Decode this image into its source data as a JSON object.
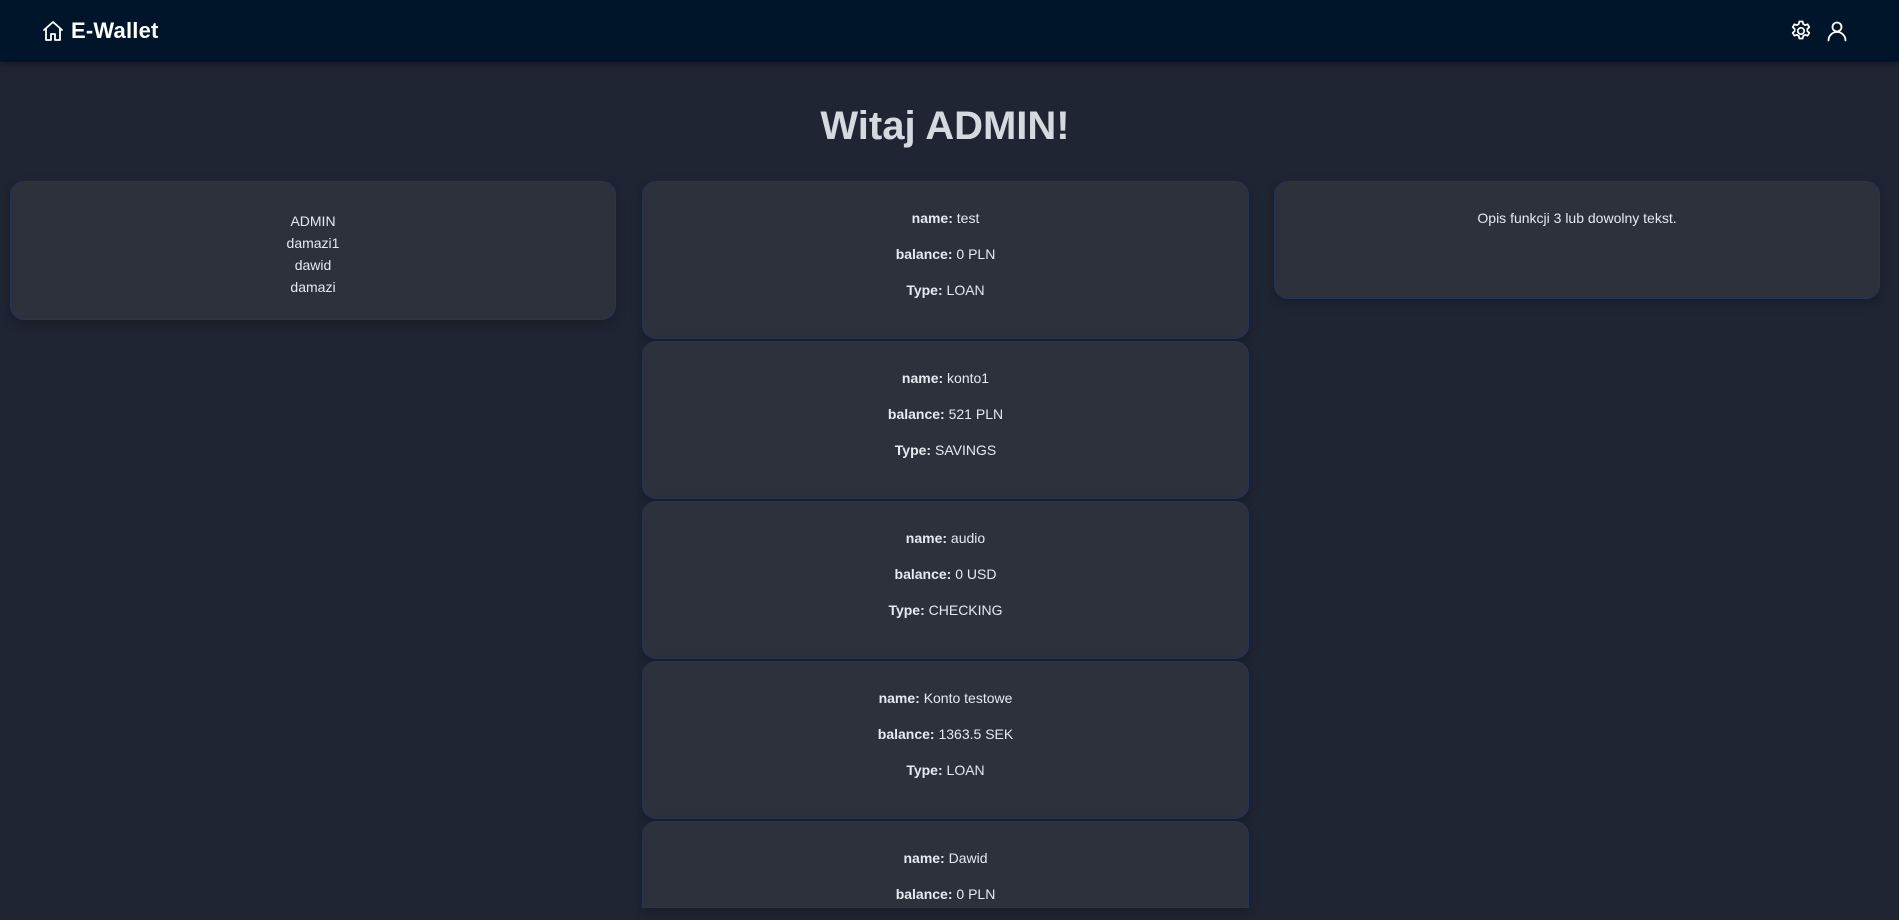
{
  "nav": {
    "title": "E-Wallet",
    "icons": [
      "home-icon",
      "settings-icon",
      "user-icon"
    ]
  },
  "greeting": "Witaj ADMIN!",
  "users": [
    "ADMIN",
    "damazi1",
    "dawid",
    "damazi"
  ],
  "info_text": "Opis funkcji 3 lub dowolny tekst.",
  "labels": {
    "name": "name:",
    "balance": "balance:",
    "type": "Type:"
  },
  "accounts": [
    {
      "name": "test",
      "balance": "0 PLN",
      "type": "LOAN"
    },
    {
      "name": "konto1",
      "balance": "521 PLN",
      "type": "SAVINGS"
    },
    {
      "name": "audio",
      "balance": "0 USD",
      "type": "CHECKING"
    },
    {
      "name": "Konto testowe",
      "balance": "1363.5 SEK",
      "type": "LOAN"
    },
    {
      "name": "Dawid",
      "balance": "0 PLN",
      "type": ""
    }
  ],
  "colors": {
    "navbar": "#00152a",
    "background": "#1f2533",
    "card": "#2c313c",
    "card_border": "#24355a"
  }
}
